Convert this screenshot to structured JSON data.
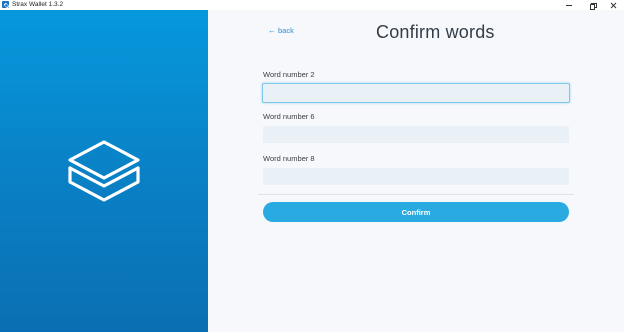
{
  "window": {
    "title": "Strax Wallet 1.3.2",
    "controls": {
      "minimize_icon": "minimize-icon",
      "maximize_icon": "restore-icon",
      "close_icon": "close-icon"
    }
  },
  "side_panel": {
    "logo_icon": "stacked-layers-logo-icon",
    "background_color": "#0a86cc"
  },
  "main": {
    "back_arrow": "←",
    "back_label": "back",
    "title": "Confirm words",
    "fields": [
      {
        "label": "Word number 2",
        "value": "",
        "placeholder": ""
      },
      {
        "label": "Word number 6",
        "value": "",
        "placeholder": ""
      },
      {
        "label": "Word number 8",
        "value": "",
        "placeholder": ""
      }
    ],
    "confirm_label": "Confirm",
    "accent_color": "#29abe2",
    "link_color": "#2a8fd6"
  }
}
